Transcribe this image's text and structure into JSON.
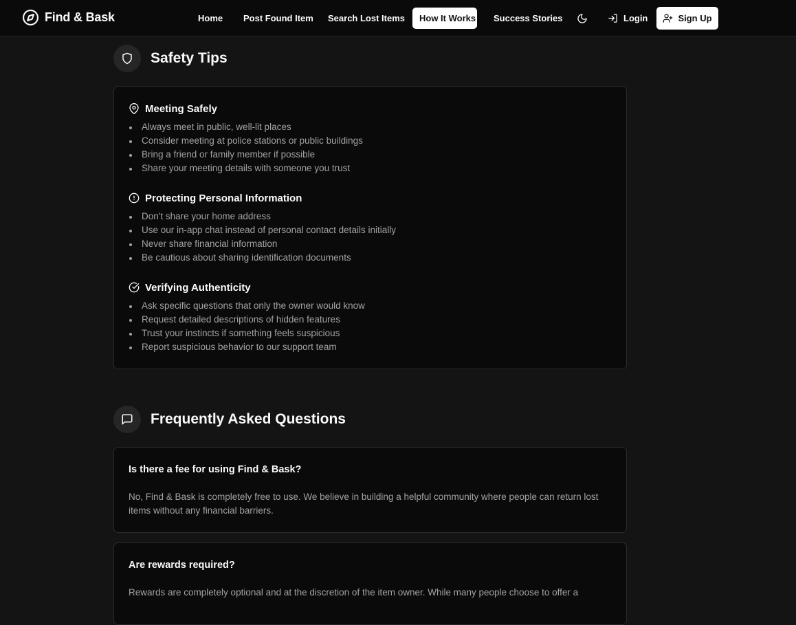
{
  "nav": {
    "brand": "Find & Bask",
    "links": [
      {
        "label": "Home"
      },
      {
        "label": "Post Found Item"
      },
      {
        "label": "Search Lost Items"
      },
      {
        "label": "How It Works",
        "active": true
      },
      {
        "label": "Success Stories"
      }
    ],
    "theme_toggle_icon": "moon-icon",
    "login_label": "Login",
    "signup_label": "Sign Up"
  },
  "safety": {
    "title": "Safety Tips",
    "icon": "shield-icon",
    "groups": [
      {
        "icon": "map-pin-icon",
        "heading": "Meeting Safely",
        "items": [
          "Always meet in public, well-lit places",
          "Consider meeting at police stations or public buildings",
          "Bring a friend or family member if possible",
          "Share your meeting details with someone you trust"
        ]
      },
      {
        "icon": "alert-circle-icon",
        "heading": "Protecting Personal Information",
        "items": [
          "Don't share your home address",
          "Use our in-app chat instead of personal contact details initially",
          "Never share financial information",
          "Be cautious about sharing identification documents"
        ]
      },
      {
        "icon": "check-circle-icon",
        "heading": "Verifying Authenticity",
        "items": [
          "Ask specific questions that only the owner would know",
          "Request detailed descriptions of hidden features",
          "Trust your instincts if something feels suspicious",
          "Report suspicious behavior to our support team"
        ]
      }
    ]
  },
  "faq": {
    "title": "Frequently Asked Questions",
    "icon": "message-square-icon",
    "items": [
      {
        "question": "Is there a fee for using Find & Bask?",
        "answer": "No, Find & Bask is completely free to use. We believe in building a helpful community where people can return lost items without any financial barriers."
      },
      {
        "question": "Are rewards required?",
        "answer": "Rewards are completely optional and at the discretion of the item owner. While many people choose to offer a"
      }
    ]
  },
  "colors": {
    "background": "#141414",
    "card": "#0a0a0a",
    "muted_text": "#a3a3a3",
    "accent": "#ffffff"
  }
}
